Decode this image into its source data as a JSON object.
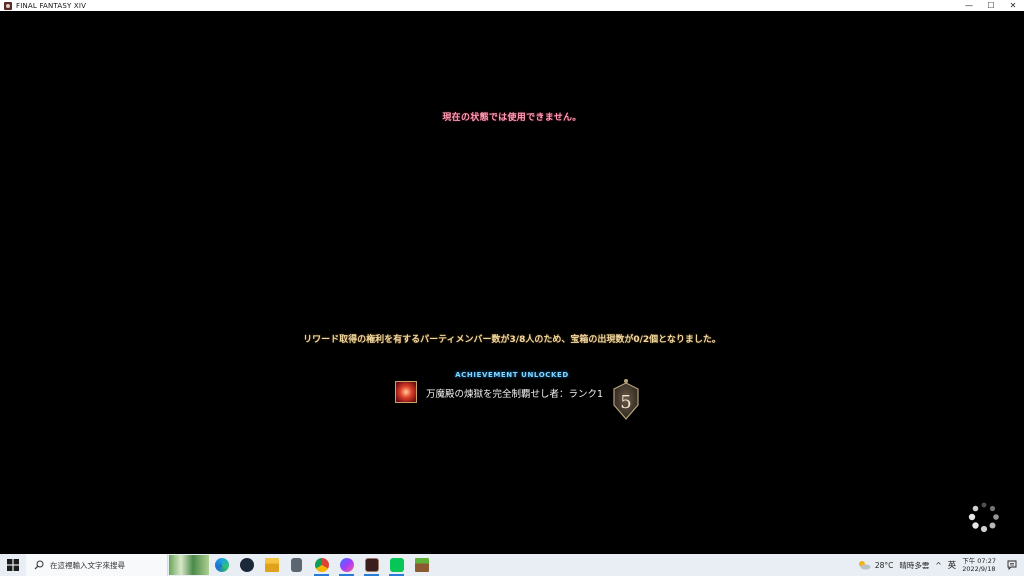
{
  "window": {
    "title": "FINAL FANTASY XIV",
    "controls": {
      "minimize": "—",
      "maximize": "☐",
      "close": "✕"
    }
  },
  "game": {
    "error_message": "現在の状態では使用できません。",
    "reward_message": "リワード取得の権利を有するパーティメンバー数が3/8人のため、宝箱の出現数が0/2個となりました。",
    "achievement": {
      "header": "ACHIEVEMENT UNLOCKED",
      "name": "万魔殿の煉獄を完全制覇せし者：ランク1",
      "points": "5"
    }
  },
  "taskbar": {
    "search_placeholder": "在這裡輸入文字來搜尋",
    "apps": [
      "edge-icon",
      "steam-icon",
      "file-explorer-icon",
      "calculator-icon",
      "chrome-icon",
      "messenger-icon",
      "ffxiv-icon",
      "line-icon",
      "minecraft-icon"
    ],
    "weather": {
      "temp": "28°C",
      "condition": "晴時多雲"
    },
    "ime": "英",
    "chevron": "^",
    "clock": {
      "time": "下午 07:27",
      "date": "2022/9/18"
    }
  },
  "colors": {
    "error_text": "#ff9bb0",
    "reward_text": "#f2d9a0",
    "achievement_header": "#7fd7ff",
    "taskbar_bg": "#e9eef4"
  }
}
